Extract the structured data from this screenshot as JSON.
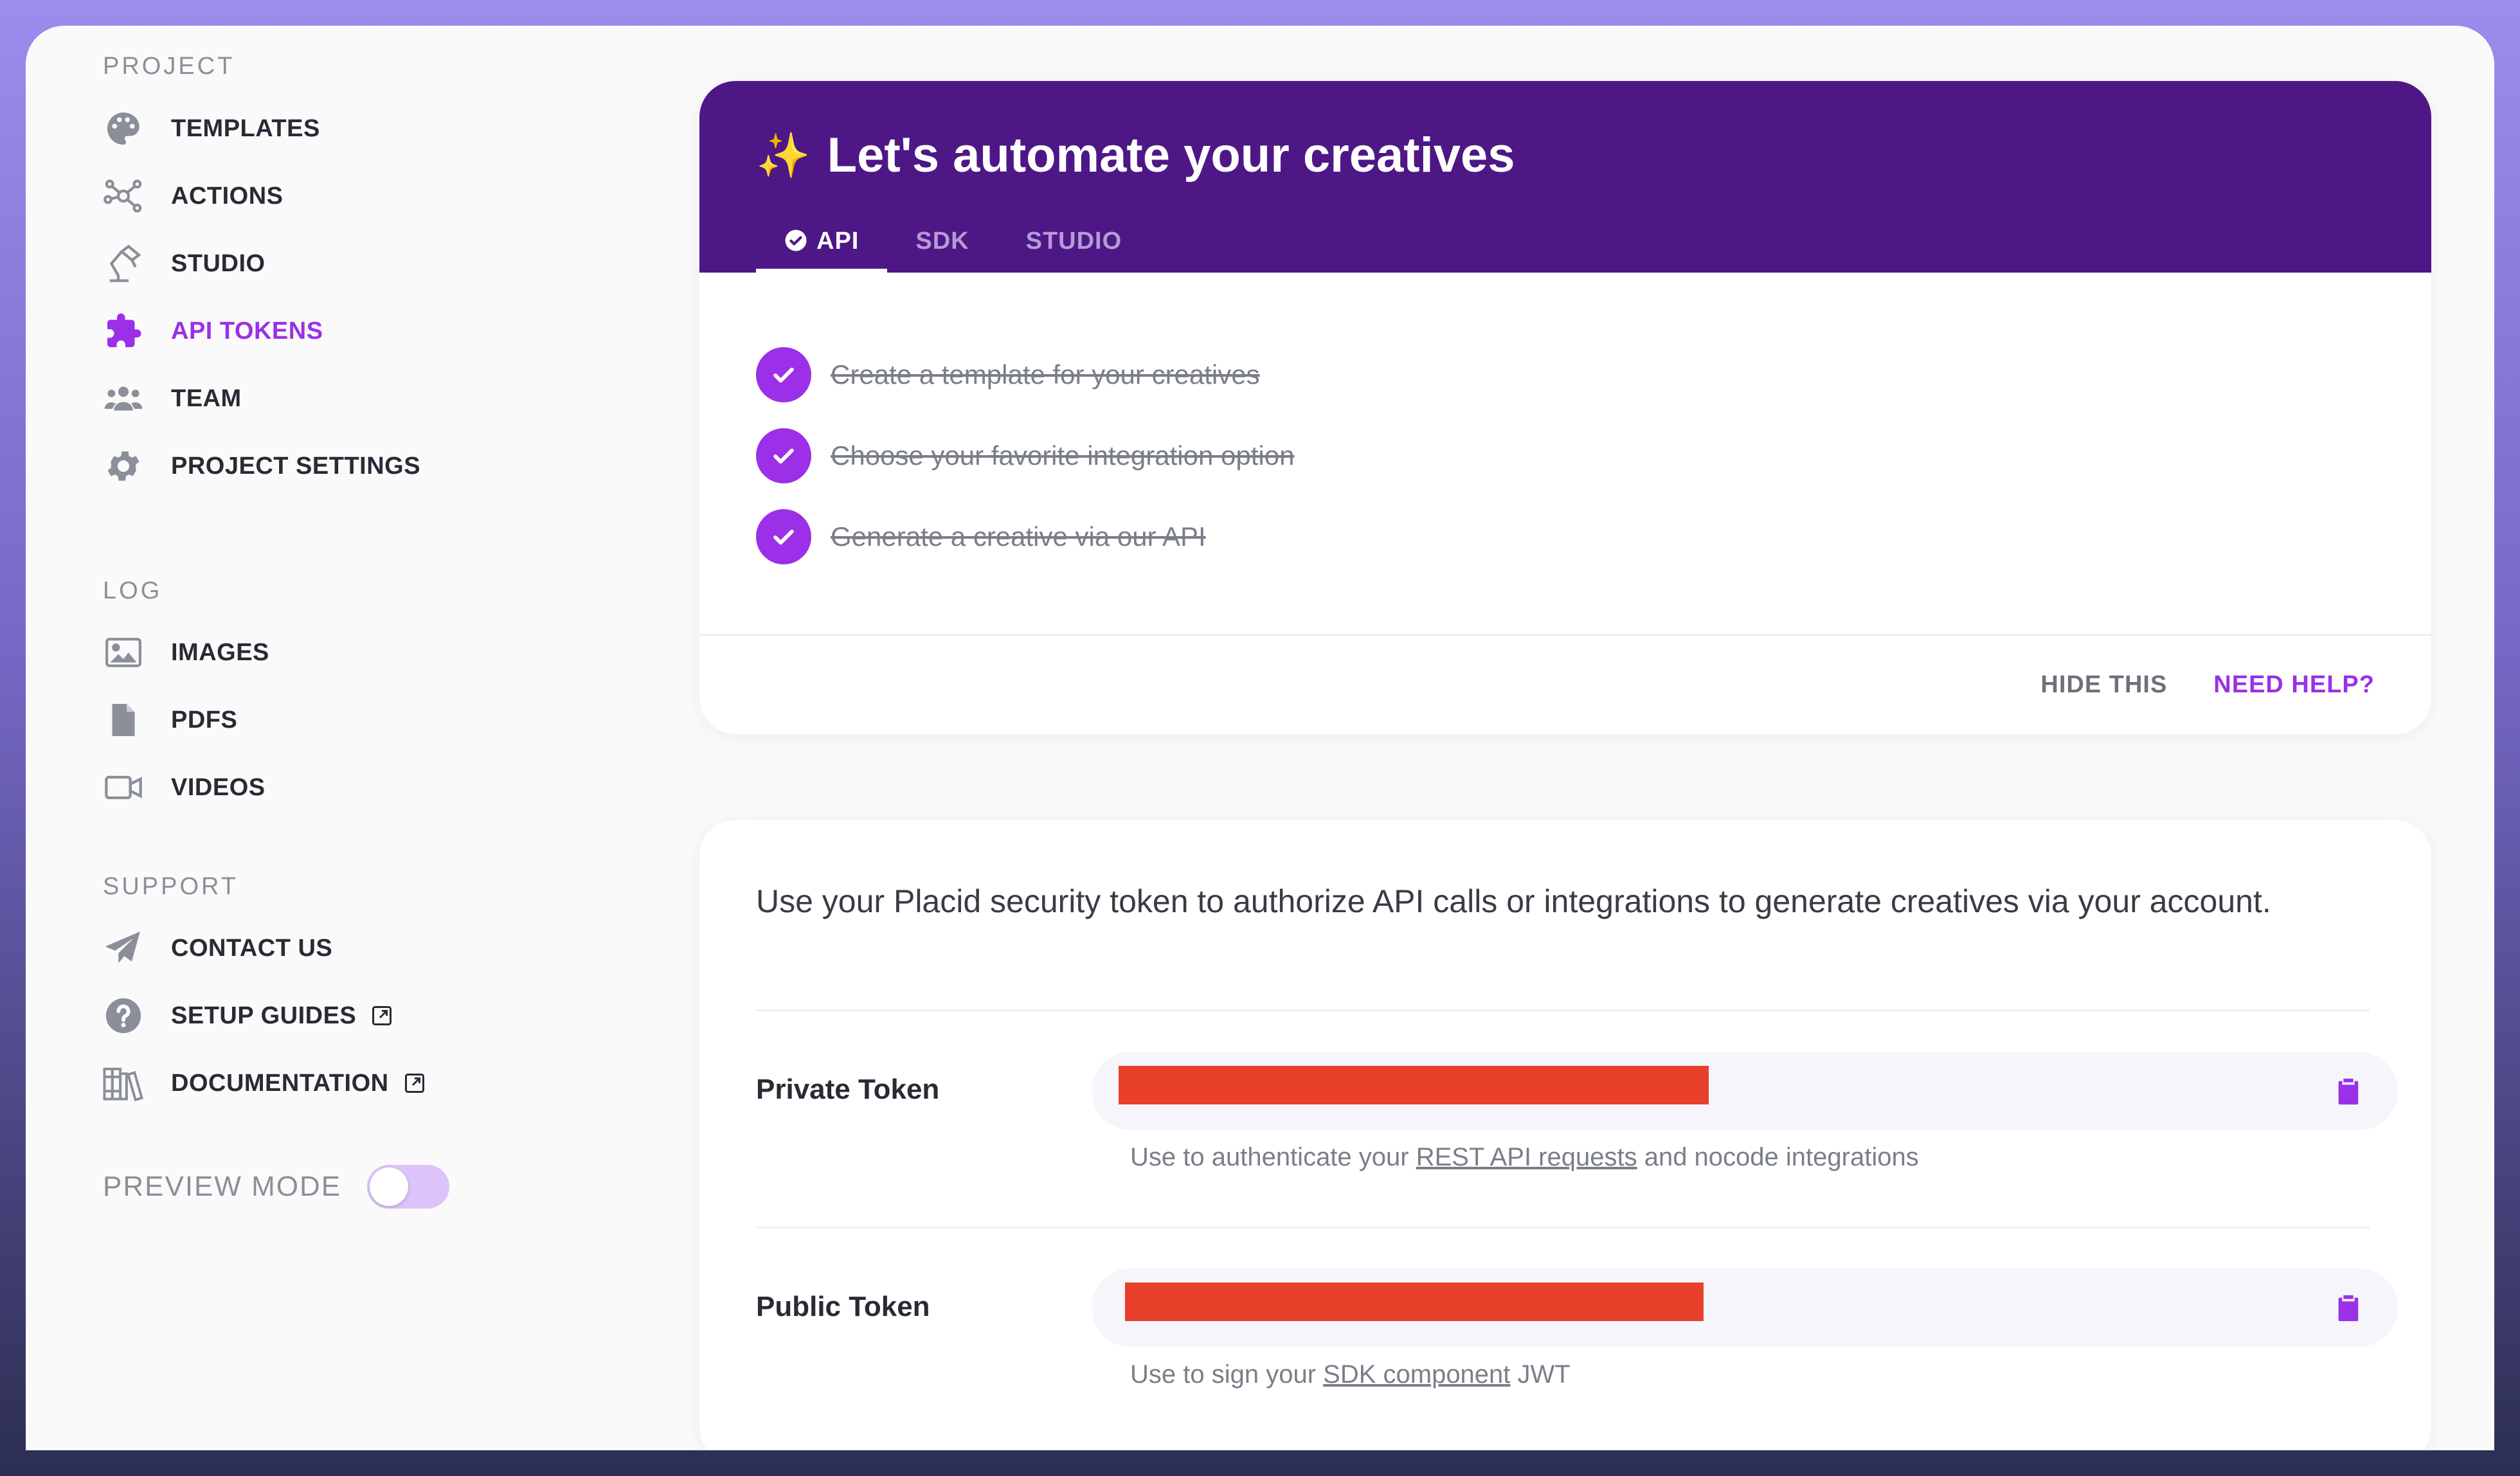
{
  "sidebar": {
    "sections": {
      "project": "PROJECT",
      "log": "LOG",
      "support": "SUPPORT"
    },
    "items": {
      "templates": "TEMPLATES",
      "actions": "ACTIONS",
      "studio": "STUDIO",
      "api_tokens": "API TOKENS",
      "team": "TEAM",
      "project_settings": "PROJECT SETTINGS",
      "images": "IMAGES",
      "pdfs": "PDFS",
      "videos": "VIDEOS",
      "contact_us": "CONTACT US",
      "setup_guides": "SETUP GUIDES",
      "documentation": "DOCUMENTATION"
    },
    "active_item": "api_tokens",
    "preview_mode": {
      "label": "PREVIEW MODE",
      "enabled": false
    }
  },
  "onboarding": {
    "icon": "sparkles-icon",
    "title": "Let's automate your creatives",
    "tabs": [
      "API",
      "SDK",
      "STUDIO"
    ],
    "active_tab": "API",
    "steps": [
      "Create a template for your creatives",
      "Choose your favorite integration option",
      "Generate a creative via our API"
    ],
    "hide_label": "HIDE THIS",
    "help_label": "NEED HELP?"
  },
  "tokens": {
    "description": "Use your Placid security token to authorize API calls or integrations to generate creatives via your account.",
    "private": {
      "label": "Private Token",
      "hint_prefix": "Use to authenticate your ",
      "hint_link": "REST API requests",
      "hint_suffix": " and nocode integrations"
    },
    "public": {
      "label": "Public Token",
      "hint_prefix": "Use to sign your ",
      "hint_link": "SDK component",
      "hint_suffix": " JWT"
    }
  },
  "colors": {
    "accent": "#9b30e8",
    "hero": "#4e1786",
    "redaction": "#e8402a"
  }
}
